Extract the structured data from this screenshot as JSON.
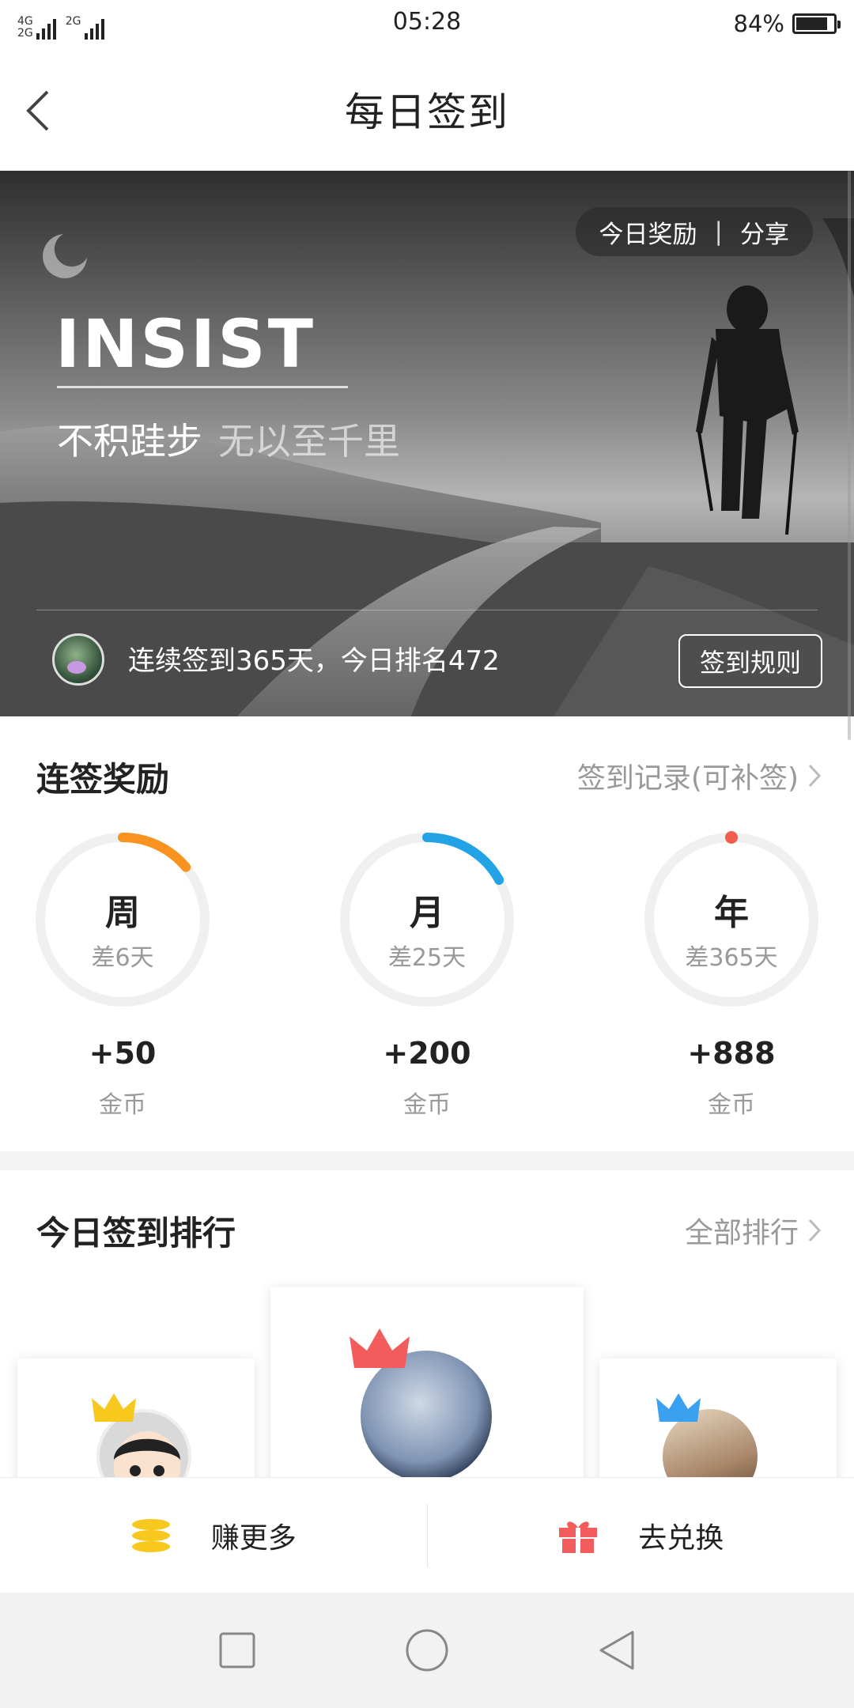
{
  "status_bar": {
    "network": "4G⁠2G",
    "network_top": "4G",
    "network_bottom": "2G",
    "network2": "2G",
    "time": "05:28",
    "battery_percent": "84%",
    "battery_level": 0.84
  },
  "header": {
    "title": "每日签到"
  },
  "banner": {
    "pill_reward": "今日奖励",
    "pill_sep": "|",
    "pill_share": "分享",
    "headline": "INSIST",
    "motto_1": "不积跬步",
    "motto_2": "无以至千里",
    "streak_text": "连续签到365天，今日排名472",
    "rules_button": "签到规则"
  },
  "streak_rewards": {
    "title": "连签奖励",
    "record_link": "签到记录(可补签)",
    "items": [
      {
        "period": "周",
        "remaining": "差6天",
        "reward": "+50",
        "unit": "金币",
        "color": "#f7931e",
        "progress": 0.14
      },
      {
        "period": "月",
        "remaining": "差25天",
        "reward": "+200",
        "unit": "金币",
        "color": "#22a3e6",
        "progress": 0.17
      },
      {
        "period": "年",
        "remaining": "差365天",
        "reward": "+888",
        "unit": "金币",
        "color": "#f25c4c",
        "progress": 0.0
      }
    ]
  },
  "ranking": {
    "title": "今日签到排行",
    "all_link": "全部排行",
    "crown_colors": {
      "first": "#f25c5c",
      "second": "#f7c81e",
      "third": "#3aa0f0"
    }
  },
  "actions": {
    "earn_more": "赚更多",
    "redeem": "去兑换",
    "earn_icon_color": "#f7c81e",
    "redeem_icon_color": "#f25c5c"
  }
}
